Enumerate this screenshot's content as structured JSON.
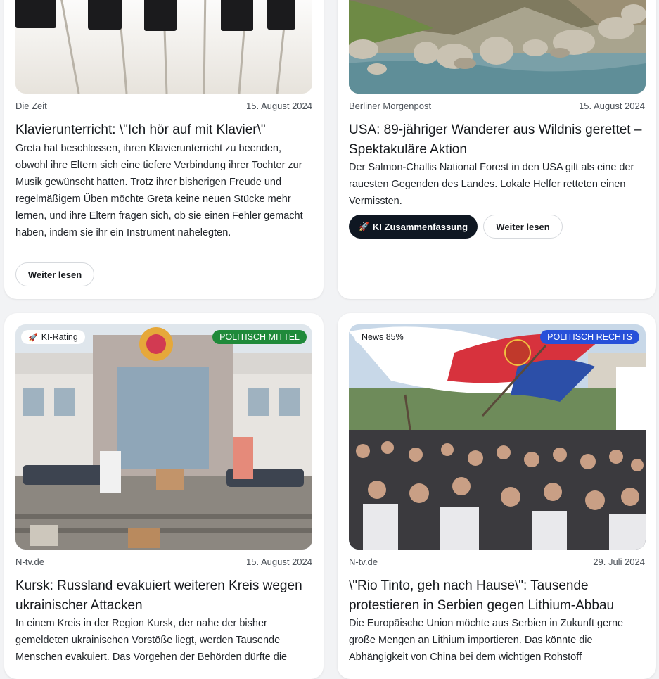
{
  "cards": [
    {
      "source": "Die Zeit",
      "date": "15. August 2024",
      "title": "Klavierunterricht: \\\"Ich hör auf mit Klavier\\\"",
      "desc": "Greta hat beschlossen, ihren Klavierunterricht zu beenden, obwohl ihre Eltern sich eine tiefere Verbindung ihrer Tochter zur Musik gewünscht hatten. Trotz ihrer bisherigen Freude und regelmäßigem Üben möchte Greta keine neuen Stücke mehr lernen, und ihre Eltern fragen sich, ob sie einen Fehler gemacht haben, indem sie ihr ein Instrument nahelegten.",
      "read_more": "Weiter lesen"
    },
    {
      "source": "Berliner Morgenpost",
      "date": "15. August 2024",
      "title": "USA: 89-jähriger Wanderer aus Wildnis gerettet – Spektakuläre Aktion",
      "desc": "Der Salmon-Challis National Forest in den USA gilt als eine der rauesten Gegenden des Landes. Lokale Helfer retteten einen Vermissten.",
      "ai_summary": "KI Zusammenfassung",
      "read_more": "Weiter lesen"
    },
    {
      "badge_left": "KI-Rating",
      "badge_right": "POLITISCH MITTEL",
      "source": "N-tv.de",
      "date": "15. August 2024",
      "title": "Kursk: Russland evakuiert weiteren Kreis wegen ukrainischer Attacken",
      "desc": "In einem Kreis in der Region Kursk, der nahe der bisher gemeldeten ukrainischen Vorstöße liegt, werden Tausende Menschen evakuiert. Das Vorgehen der Behörden dürfte die"
    },
    {
      "badge_left": "News 85%",
      "badge_right": "POLITISCH RECHTS",
      "source": "N-tv.de",
      "date": "29. Juli 2024",
      "title": "\\\"Rio Tinto, geh nach Hause\\\": Tausende protestieren in Serbien gegen Lithium-Abbau",
      "desc": "Die Europäische Union möchte aus Serbien in Zukunft gerne große Mengen an Lithium importieren. Das könnte die Abhängigkeit von China bei dem wichtigen Rohstoff"
    }
  ],
  "colors": {
    "dark_button": "#0f1722",
    "badge_green": "#1f8a3a",
    "badge_blue": "#2750d9"
  },
  "icons": [
    "rocket-icon"
  ]
}
